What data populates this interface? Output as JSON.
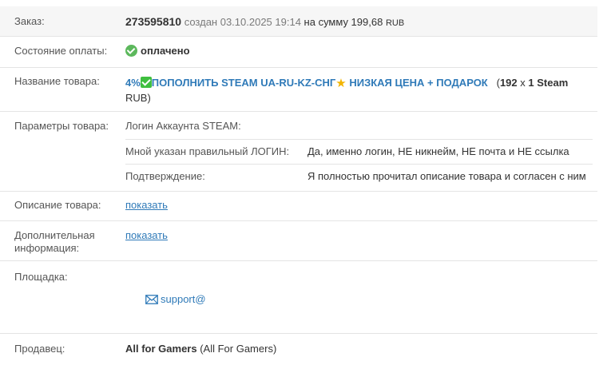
{
  "order": {
    "label": "Заказ:",
    "number": "273595810",
    "created_text": "создан 03.10.2025 19:14",
    "sum_text": "на сумму 199,68",
    "currency": "RUB"
  },
  "payment": {
    "label": "Состояние оплаты:",
    "status": "оплачено"
  },
  "product": {
    "label": "Название товара:",
    "title_part1": "4%",
    "title_part2": "ПОПОЛНИТЬ STEAM UA-RU-KZ-СНГ",
    "title_part3": "НИЗКАЯ ЦЕНА + ПОДАРОК",
    "qty_open": "(",
    "qty_num": "192",
    "qty_x": "x",
    "qty_unit": "1 Steam",
    "qty_tail": "RUB)"
  },
  "params": {
    "label": "Параметры товара:",
    "items": [
      {
        "name": "Логин Аккаунта STEAM:",
        "value": ""
      },
      {
        "name": "Мной указан правильный ЛОГИН:",
        "value": "Да, именно логин, НЕ никнейм, НЕ почта и НЕ ссылка"
      },
      {
        "name": "Подтверждение:",
        "value": "Я полностью прочитал описание товара и согласен с ним"
      }
    ]
  },
  "description": {
    "label": "Описание товара:",
    "link": "показать"
  },
  "extra": {
    "label_line1": "Дополнительная",
    "label_line2": "информация:",
    "link": "показать"
  },
  "platform": {
    "label": "Площадка:",
    "email": "support@"
  },
  "seller": {
    "label": "Продавец:",
    "name": "All for Gamers",
    "name_paren": "(All For Gamers)"
  },
  "colors": {
    "link": "#2f7ab8",
    "paid_green": "#5cb85c",
    "star": "#f2b400"
  },
  "icons": [
    "paid-check-icon",
    "green-check-emoji-icon",
    "star-emoji-icon",
    "envelope-icon"
  ]
}
